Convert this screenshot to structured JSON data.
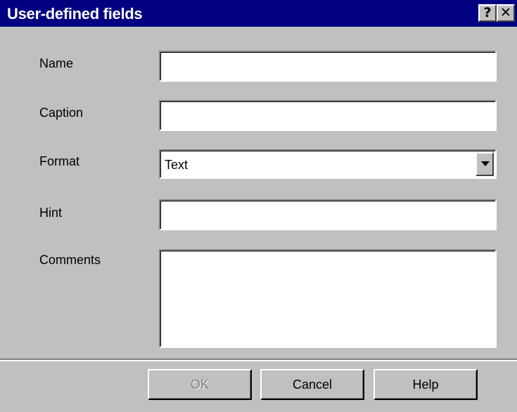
{
  "window": {
    "title": "User-defined fields",
    "help_button": "?",
    "close_button": "✕"
  },
  "form": {
    "name": {
      "label": "Name",
      "value": ""
    },
    "caption": {
      "label": "Caption",
      "value": ""
    },
    "format": {
      "label": "Format",
      "selected": "Text"
    },
    "hint": {
      "label": "Hint",
      "value": ""
    },
    "comments": {
      "label": "Comments",
      "value": ""
    }
  },
  "buttons": {
    "ok": "OK",
    "cancel": "Cancel",
    "help": "Help"
  },
  "colors": {
    "titlebar": "#000080",
    "face": "#c0c0c0"
  }
}
